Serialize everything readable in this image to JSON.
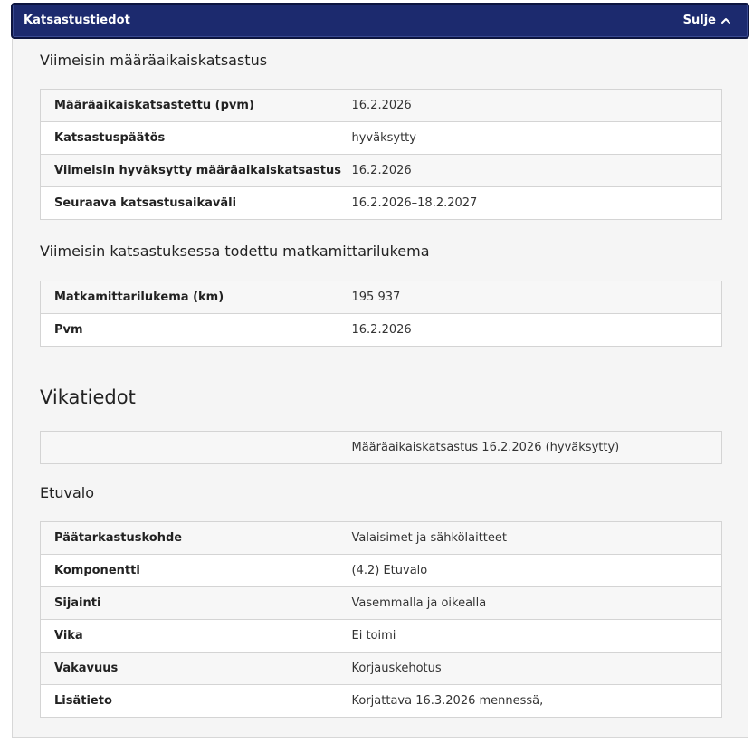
{
  "header": {
    "title": "Katsastustiedot",
    "toggle_label": "Sulje"
  },
  "latest_inspection": {
    "heading": "Viimeisin määräaikaiskatsastus",
    "rows": [
      {
        "label": "Määräaikaiskatsastettu (pvm)",
        "value": "16.2.2026"
      },
      {
        "label": "Katsastuspäätös",
        "value": "hyväksytty"
      },
      {
        "label": "Viimeisin hyväksytty määräaikaiskatsastus",
        "value": "16.2.2026"
      },
      {
        "label": "Seuraava katsastusaikaväli",
        "value": "16.2.2026–18.2.2027"
      }
    ]
  },
  "odometer": {
    "heading": "Viimeisin katsastuksessa todettu matkamittarilukema",
    "rows": [
      {
        "label": "Matkamittarilukema (km)",
        "value": "195 937"
      },
      {
        "label": "Pvm",
        "value": "16.2.2026"
      }
    ]
  },
  "faults": {
    "heading": "Vikatiedot",
    "summary_row": {
      "label": "",
      "value": "Määräaikaiskatsastus 16.2.2026 (hyväksytty)"
    },
    "fault_heading": "Etuvalo",
    "rows": [
      {
        "label": "Päätarkastuskohde",
        "value": "Valaisimet ja sähkölaitteet"
      },
      {
        "label": "Komponentti",
        "value": "(4.2) Etuvalo"
      },
      {
        "label": "Sijainti",
        "value": "Vasemmalla ja oikealla"
      },
      {
        "label": "Vika",
        "value": "Ei toimi"
      },
      {
        "label": "Vakavuus",
        "value": "Korjauskehotus"
      },
      {
        "label": "Lisätieto",
        "value": "Korjattava 16.3.2026 mennessä,"
      }
    ]
  },
  "colors": {
    "header_bg": "#1c2a6e",
    "body_bg": "#f5f5f5"
  },
  "icons": {
    "toggle": "chevron-up-icon"
  }
}
